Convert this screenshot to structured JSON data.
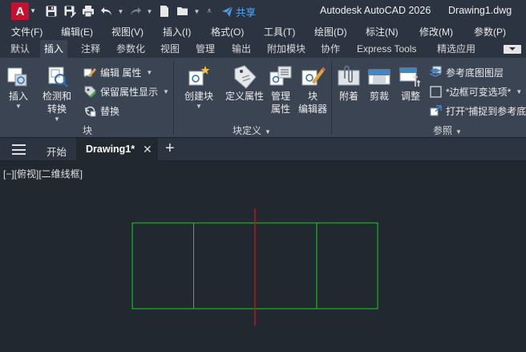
{
  "titlebar": {
    "logo_letter": "A",
    "share_label": "共享",
    "app_title": "Autodesk AutoCAD 2026",
    "doc_title": "Drawing1.dwg"
  },
  "menubar": {
    "items": [
      "文件(F)",
      "编辑(E)",
      "视图(V)",
      "插入(I)",
      "格式(O)",
      "工具(T)",
      "绘图(D)",
      "标注(N)",
      "修改(M)",
      "参数(P)"
    ]
  },
  "ribbon_tabs": {
    "items": [
      "默认",
      "插入",
      "注释",
      "参数化",
      "视图",
      "管理",
      "输出",
      "附加模块",
      "协作",
      "Express Tools",
      "精选应用"
    ],
    "active": "插入"
  },
  "ribbon": {
    "block_panel": {
      "title": "块",
      "insert_label": "插入",
      "detect_label_1": "检测和",
      "detect_label_2": "转换",
      "edit_attr_label": "编辑 属性",
      "retain_attr_label": "保留属性显示",
      "replace_label": "替换"
    },
    "block_def_panel": {
      "title": "块定义",
      "create_label": "创建块",
      "define_attr_label": "定义属性",
      "manage_attr_label_1": "管理",
      "manage_attr_label_2": "属性",
      "block_editor_label_1": "块",
      "block_editor_label_2": "编辑器"
    },
    "reference_panel": {
      "title": "参照",
      "attach_label": "附着",
      "clip_label": "剪裁",
      "adjust_label": "调整",
      "underlay_layers_label": "参考底图图层",
      "frame_variable_label": "*边框可变选项*",
      "snap_label": "打开\"捕捉到参考底"
    }
  },
  "filetabs": {
    "start_label": "开始",
    "drawing_label": "Drawing1*",
    "close_glyph": "✕",
    "new_glyph": "+"
  },
  "canvas": {
    "viewport_label": "[−][俯视][二维线框]",
    "rect_color": "#17d317",
    "axis_color": "#c0151c"
  }
}
